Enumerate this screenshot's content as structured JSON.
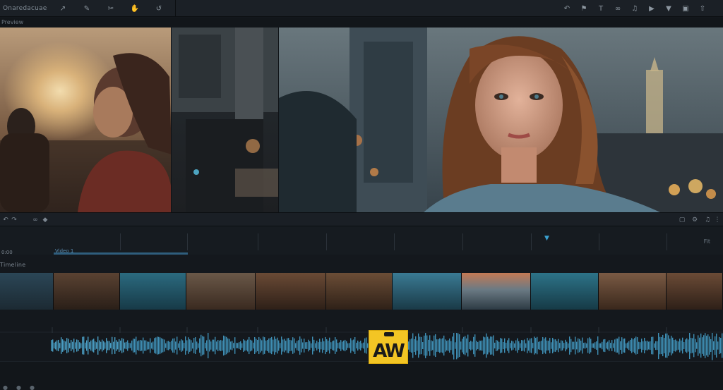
{
  "app": {
    "title": "Onaredacuae"
  },
  "toolbar": {
    "left_icons": [
      "cursor-icon",
      "pen-icon",
      "scissors-icon",
      "hand-icon",
      "ripple-icon"
    ],
    "right_icons": [
      "undo-icon",
      "flag-icon",
      "text-icon",
      "link-icon",
      "speaker-icon",
      "play-icon",
      "marker-icon",
      "crop-icon",
      "export-icon"
    ]
  },
  "viewer": {
    "label": "Preview"
  },
  "timeline": {
    "time_display": "0:00",
    "zoom_label": "Fit",
    "track_name": "Video 1",
    "track_header": "Timeline"
  },
  "watermark": {
    "text": "AW",
    "color": "#f3c524"
  },
  "colors": {
    "accent": "#3aa1d0",
    "background": "#14181d",
    "panel": "#1b2026"
  }
}
